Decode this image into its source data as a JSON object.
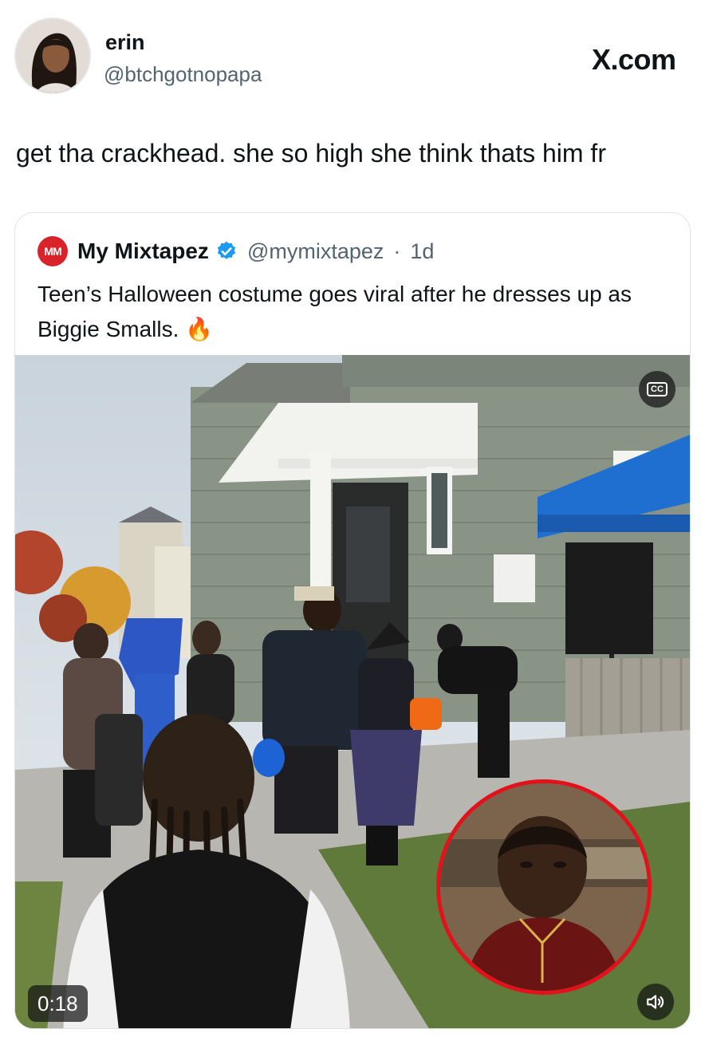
{
  "author": {
    "name": "erin",
    "handle": "@btchgotnopapa",
    "avatar_icon": "profile-photo"
  },
  "brand": {
    "label": "X.com"
  },
  "tweet": {
    "text": "get tha crackhead. she so high she think thats him fr"
  },
  "quote": {
    "logo_text": "MM",
    "name": "My Mixtapez",
    "verified_icon": "verified-badge-icon",
    "handle": "@mymixtapez",
    "separator": "·",
    "age": "1d",
    "text": "Teen’s Halloween costume goes viral after he dresses up as Biggie Smalls. 🔥"
  },
  "video": {
    "duration": "0:18",
    "captions_label": "CC",
    "captions_icon": "closed-captions-icon",
    "sound_icon": "speaker-icon"
  },
  "colors": {
    "verified": "#1d9bf0",
    "inset_ring": "#e3111b",
    "logo": "#d9232a"
  }
}
